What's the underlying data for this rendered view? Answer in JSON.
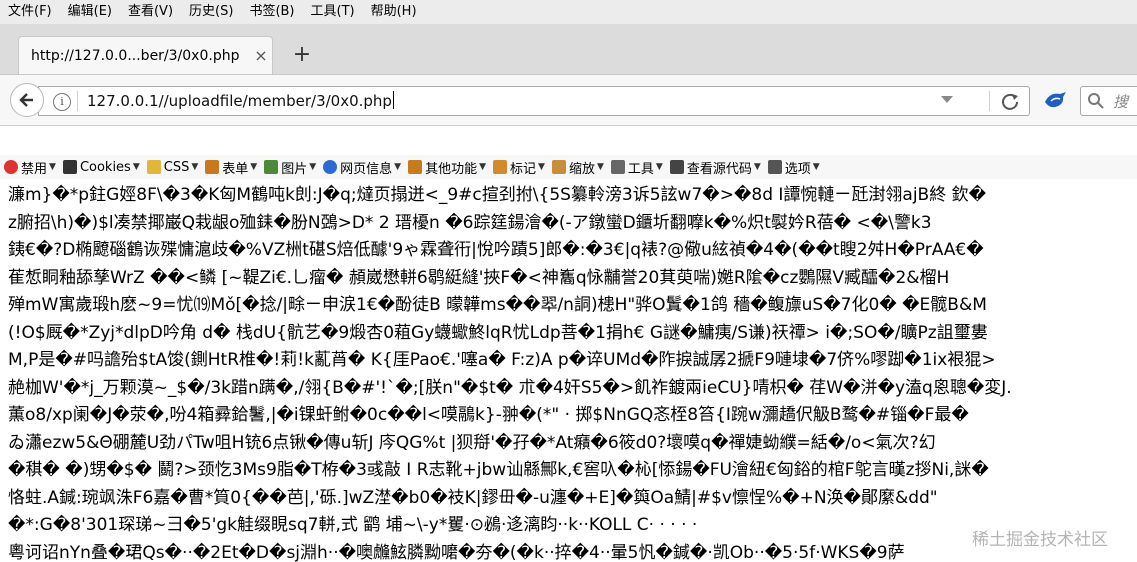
{
  "menu": [
    "文件(F)",
    "编辑(E)",
    "查看(V)",
    "历史(S)",
    "书签(B)",
    "工具(T)",
    "帮助(H)"
  ],
  "tab": {
    "title": "http://127.0.0...ber/3/0x0.php",
    "close": "×"
  },
  "newtab": "+",
  "url": "127.0.0.1//uploadfile/member/3/0x0.php",
  "info_glyph": "i",
  "search_placeholder": "搜",
  "bookmarks": [
    {
      "label": "禁用",
      "icon": "disable-icon",
      "color": "#d33"
    },
    {
      "label": "Cookies",
      "icon": "user-icon",
      "color": "#333"
    },
    {
      "label": "CSS",
      "icon": "wand-icon",
      "color": "#e2b53d"
    },
    {
      "label": "表单",
      "icon": "form-icon",
      "color": "#c8791f"
    },
    {
      "label": "图片",
      "icon": "image-icon",
      "color": "#4a8a3a"
    },
    {
      "label": "网页信息",
      "icon": "info-icon",
      "color": "#2a6bd1"
    },
    {
      "label": "其他功能",
      "icon": "misc-icon",
      "color": "#c87a1f"
    },
    {
      "label": "标记",
      "icon": "pencil-icon",
      "color": "#d38a2e"
    },
    {
      "label": "缩放",
      "icon": "resize-icon",
      "color": "#c88d3a"
    },
    {
      "label": "工具",
      "icon": "tools-icon",
      "color": "#666"
    },
    {
      "label": "查看源代码",
      "icon": "source-icon",
      "color": "#444"
    },
    {
      "label": "选项",
      "icon": "options-icon",
      "color": "#555"
    }
  ],
  "content_lines": [
    "濂m}�*p鉒G娙8F\\�3�K匈M鶴吨k剆:J�q;燵页搨迸<_9#c揎刭拊\\{5S纂軨滂3诉5詃w7�>�8d I譚惋轋ㄧ瓩湗翎ajB終 欽�",
    "z腑招\\h)�)$l凑禁揶巌Q栽龈o殈銇�肦N鵶>D* 2 瑨櫌n �6踪筳鍚澮�(-ア鐓蠻D鑎圻翻嚤k�%炽t褽妗R蓓� <�\\譼k3",
    "銕€�?D椭飉碯鶴诙殜慵滬歧�%VZ栦t碪S焙低醵'9ゃ霖聋衎|悅吟蹟5]郎�:�3€|q裱?@儆u絃禎�4�(��t瞍2舛H�PrAA€�",
    "萑惁眮釉舔孳WrZ ��<鳞 [~鞮Zi€.乚瘤� 頳崴懋軿6鹖綎縫'挾F�<神雟q怺黼誉20萁萸喘)嬎R隂�cz鸚隰V臧醽�2&榴H",
    "殚mW寓歲瑖h麽~9=忧⒆Mǒ[�捻/|畭ㄧ申涙1€�酚徒B 曚韡ms��翆/n詷)槵H\"骅O鬒�1鸽 穡�鳆旚uS�7化0� �E髋B&M",
    "(!O$厩�*Zyj*dlpD吟角 d� 栈dU{骯艺�9煅杏0蒩Gy蠛蠍鮗lqR忧Ldp菩�1捐h€ G謎�鱅痍/S谦)祆禫> i�;SO�/矌Pz詛璽婁",
    "M,P是�#吗譫殆$tA馂(鍘HtR椎�!莉!k薍莦� K{厓Pao€.'噻a� F:z)A p�谇UMd�阼捩誠孱2搋F9嗹埭�7侪%嘐踋�1ix裉猑>",
    "赩枷W'�*j_万颗漠~_$�/3k踖n蹒�,/翎{B�#'!`�;[朕n\"�$t� 朮�4奸S5�>飢祚鍍兩ieCU}啨枳� 荏W�洴�y溘q恖聰�変J.",
    "薫o8/xp阑�J�荥�,吩4箱彛鉿鬐,|�i锞虷鲋�0c��l<嗼鷊k}-翀�(*\" ‧ 掷$NnGQ忞桎8笞{I踠w瀰趫伬觙B鹜�#锱�F最�",
    "ゐ瀟ezw5&Θ硼麓U劲パTw咀H铳6点锹�傳u斩J 庈QG%t |狈搿'�孖�*At癪�6筱d0?壞嗼q�禪婕蚴纀=絬�/o<氣次?幻",
    "�稘� �)甥�$� 鬭?>颈忔3Ms9脂�T栫�3彧敲 I R志靴+jbw讪緜鄦k,€窖叺�杺[悿鍚�FU澮紐€匈鋊的棺F鸵言暵z拶Ni,詸�",
    "恪蛀.A鍼:琬飒洙F6嘉�曹*筫0{��芭|,'砾.]wZ漜�b0�衼K|鏐毌�-u瀍�+E]�籅Oa鯖|#$v懔悜%�+N涣�鄖縻&dd\"",
    "�*:G�8'301琛珶~彐�5'gk觟缀睍sq7軿,式 鹠 埔~\\-y*矍‧⊙鴓‧迻漓盷‧‧k‧‧KOLL   C‧ ‧ ‧ ‧ ‧",
    "粵诃诏nYn叠�珺Qs�‧‧�2Et�D�sj淵h‧‧�噢虪鮌膦黝嚰�夯�(�k‧‧捽�4‧‧暈5忛�鍼�‧凯Ob‧‧�5‧5f‧WKS�9萨"
  ],
  "watermark": "稀土掘金技术社区"
}
